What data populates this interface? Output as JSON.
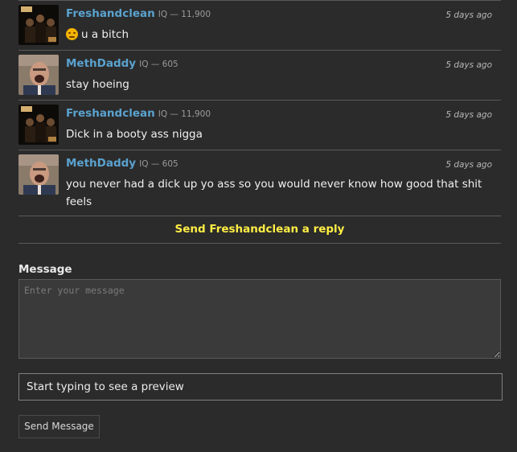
{
  "thread": {
    "messages": [
      {
        "user": "Freshandclean",
        "iq": "IQ — 11,900",
        "time": "5 days ago",
        "text": "u a bitch",
        "avatar": "album-cover",
        "emoji": "unamused-face-icon"
      },
      {
        "user": "MethDaddy",
        "iq": "IQ — 605",
        "time": "5 days ago",
        "text": "stay hoeing",
        "avatar": "man-laughing"
      },
      {
        "user": "Freshandclean",
        "iq": "IQ — 11,900",
        "time": "5 days ago",
        "text": "Dick in a booty ass nigga",
        "avatar": "album-cover"
      },
      {
        "user": "MethDaddy",
        "iq": "IQ — 605",
        "time": "5 days ago",
        "text": "you never had a dick up yo ass so you would never know how good that shit feels",
        "avatar": "man-laughing"
      }
    ]
  },
  "reply": {
    "label": "Send Freshandclean a reply"
  },
  "form": {
    "message_label": "Message",
    "message_placeholder": "Enter your message",
    "preview_text": "Start typing to see a preview",
    "send_label": "Send Message"
  },
  "colors": {
    "username": "#5aa2cf",
    "reply": "#ffee44",
    "background": "#2b2b2b"
  }
}
